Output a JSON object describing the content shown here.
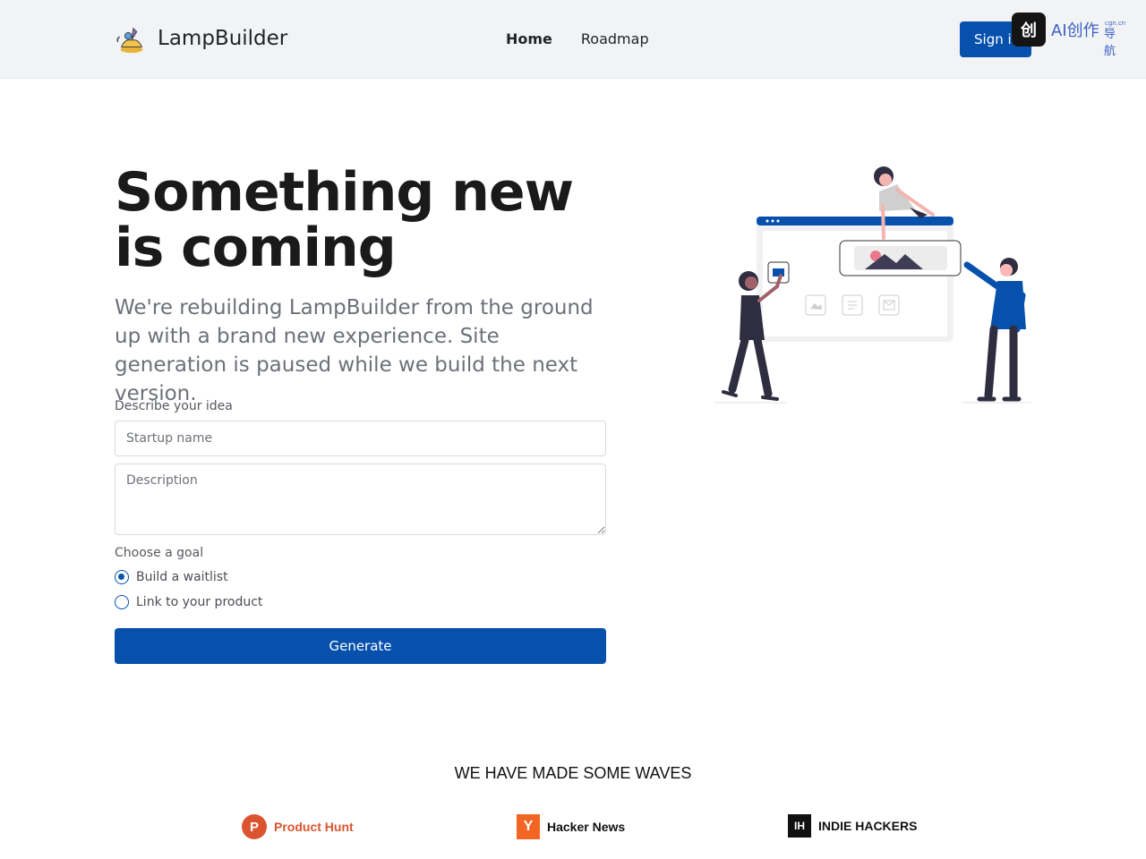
{
  "header": {
    "brand_name": "LampBuilder",
    "nav": [
      {
        "label": "Home",
        "active": true
      },
      {
        "label": "Roadmap",
        "active": false
      }
    ],
    "signin_label": "Sign in",
    "overlay_badge": {
      "icon_text": "创",
      "text": "AI创作",
      "small": "cgn.cn",
      "sub": "导航"
    }
  },
  "hero": {
    "title": "Something new is coming",
    "subtitle": "We're rebuilding LampBuilder from the ground up with a brand new experience. Site generation is paused while we build the next version."
  },
  "form": {
    "idea_label": "Describe your idea",
    "startup_placeholder": "Startup name",
    "description_placeholder": "Description",
    "goal_label": "Choose a goal",
    "goals": [
      {
        "label": "Build a waitlist",
        "selected": true
      },
      {
        "label": "Link to your product",
        "selected": false
      }
    ],
    "generate_label": "Generate"
  },
  "press": {
    "title": "WE HAVE MADE SOME WAVES",
    "logos": [
      {
        "mark": "P",
        "name": "Product Hunt",
        "color": "#da552f"
      },
      {
        "mark": "Y",
        "name": "Hacker News",
        "color": "#111111"
      },
      {
        "mark": "IH",
        "name": "INDIE HACKERS",
        "color": "#111111"
      }
    ]
  },
  "colors": {
    "primary": "#0751ad",
    "header_bg": "#f1f3f5",
    "accent_pink": "#e8788a"
  }
}
